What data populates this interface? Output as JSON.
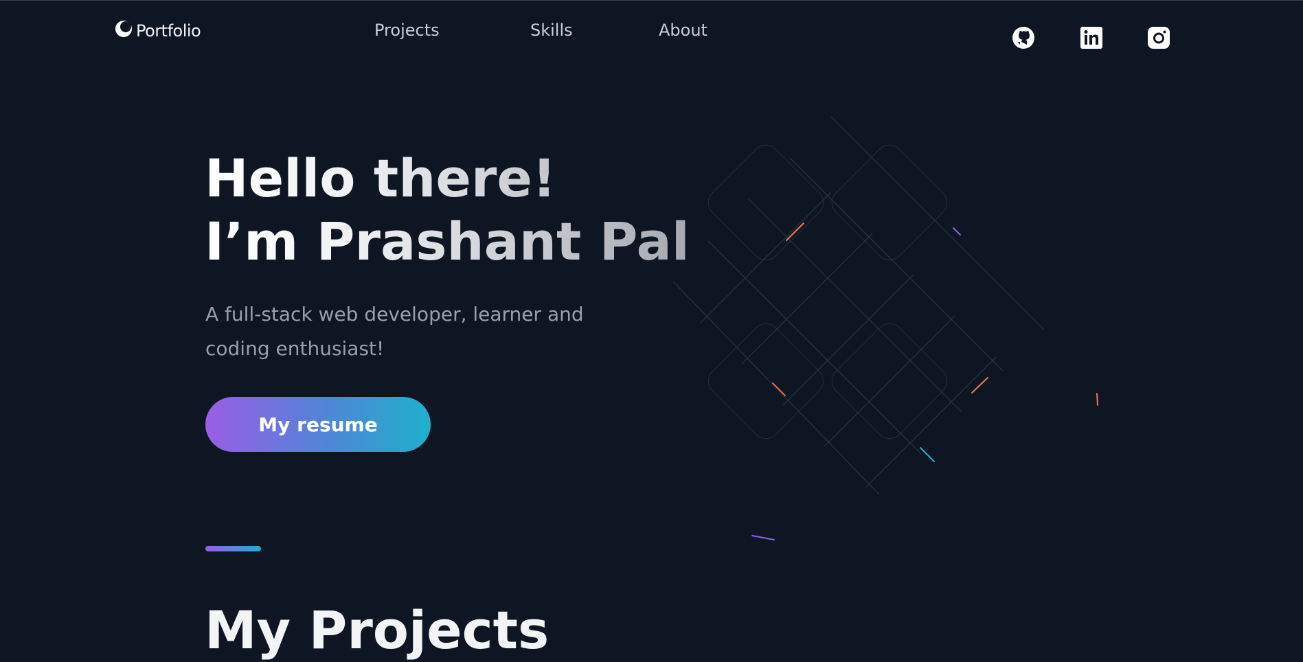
{
  "header": {
    "logo_text": "Portfolio",
    "logo_icon": "crescent-logo-icon",
    "nav": [
      {
        "label": "Projects"
      },
      {
        "label": "Skills"
      },
      {
        "label": "About"
      }
    ],
    "social": [
      {
        "icon": "github-icon"
      },
      {
        "icon": "linkedin-icon"
      },
      {
        "icon": "instagram-icon"
      }
    ]
  },
  "hero": {
    "title_line1": "Hello there!",
    "title_line2": "I’m Prashant Pal",
    "subtitle": "A full-stack web developer, learner and coding enthusiast!",
    "resume_label": "My resume"
  },
  "projects": {
    "title": "My Projects"
  },
  "colors": {
    "background": "#0f1623",
    "accent_start": "#9b5de5",
    "accent_end": "#1fb0cb",
    "muted_text": "#9aa0aa"
  }
}
